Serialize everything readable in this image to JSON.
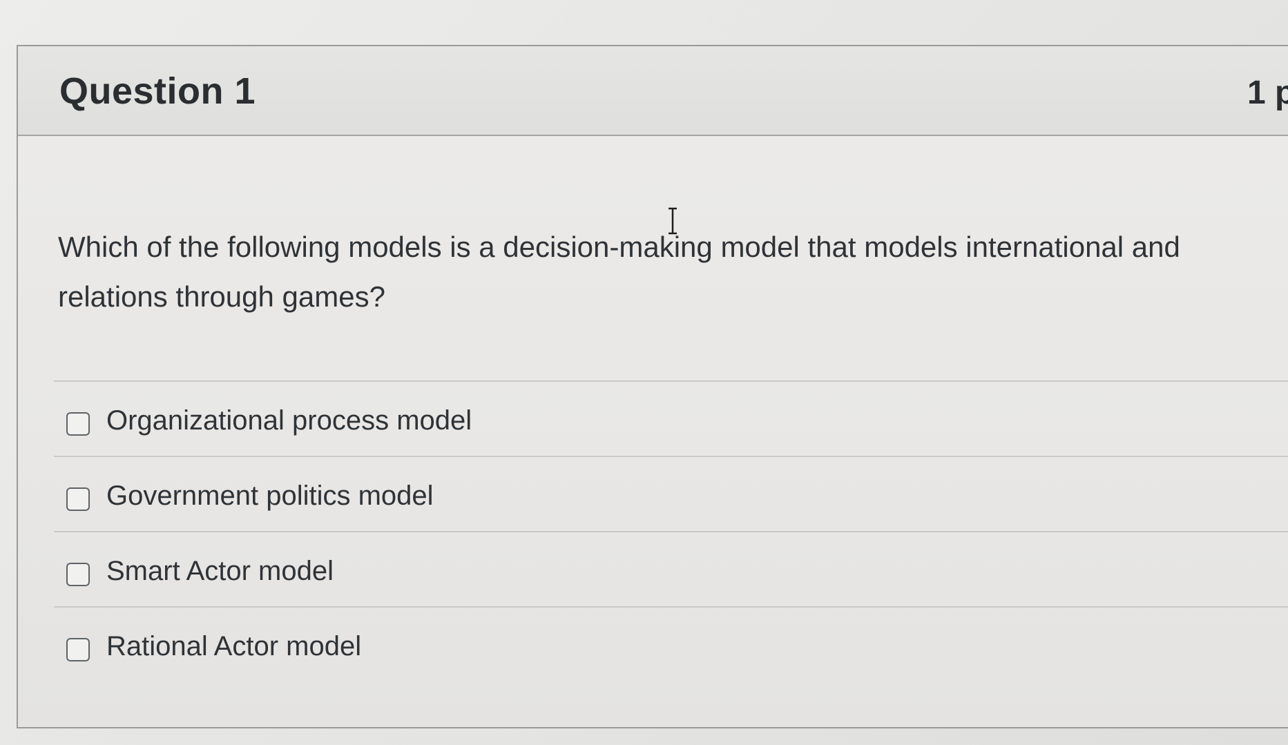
{
  "question": {
    "title": "Question 1",
    "points": "1 p",
    "text_line1": "Which of the following models is a decision-making model that models international and",
    "text_line2": "relations through games?"
  },
  "answers": [
    {
      "label": "Organizational process model",
      "checked": false
    },
    {
      "label": "Government politics model",
      "checked": false
    },
    {
      "label": "Smart Actor model",
      "checked": false
    },
    {
      "label": "Rational Actor model",
      "checked": false
    }
  ],
  "icons": {
    "cursor": "text-cursor-icon",
    "checkbox": "checkbox-icon"
  }
}
